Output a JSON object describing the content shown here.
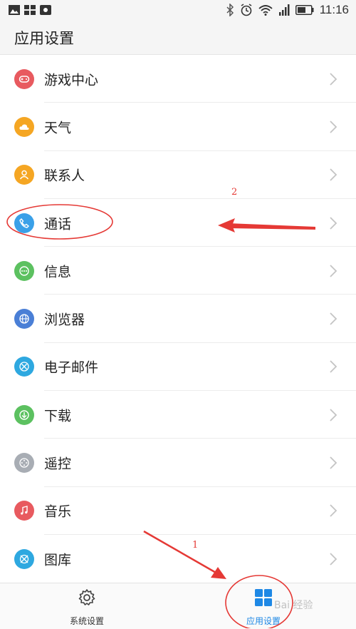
{
  "status_bar": {
    "time": "11:16"
  },
  "header": {
    "title": "应用设置"
  },
  "settings_items": [
    {
      "label": "游戏中心",
      "icon": "gamepad-icon",
      "color": "#e85a5f"
    },
    {
      "label": "天气",
      "icon": "weather-icon",
      "color": "#f5a623"
    },
    {
      "label": "联系人",
      "icon": "contacts-icon",
      "color": "#f5a623"
    },
    {
      "label": "通话",
      "icon": "phone-icon",
      "color": "#3aa0e8"
    },
    {
      "label": "信息",
      "icon": "message-icon",
      "color": "#5cc160"
    },
    {
      "label": "浏览器",
      "icon": "browser-icon",
      "color": "#4a7fd6"
    },
    {
      "label": "电子邮件",
      "icon": "email-icon",
      "color": "#2ea8e0"
    },
    {
      "label": "下载",
      "icon": "download-icon",
      "color": "#5cc160"
    },
    {
      "label": "遥控",
      "icon": "remote-icon",
      "color": "#a8adb4"
    },
    {
      "label": "音乐",
      "icon": "music-icon",
      "color": "#e85a5f"
    },
    {
      "label": "图库",
      "icon": "gallery-icon",
      "color": "#2ea8e0"
    }
  ],
  "bottom_nav": {
    "system_label": "系统设置",
    "apps_label": "应用设置",
    "active_color": "#1e88e5"
  },
  "annotations": {
    "label_1": "1",
    "label_2": "2",
    "color": "#e53935"
  },
  "watermark": "Bai 经验"
}
